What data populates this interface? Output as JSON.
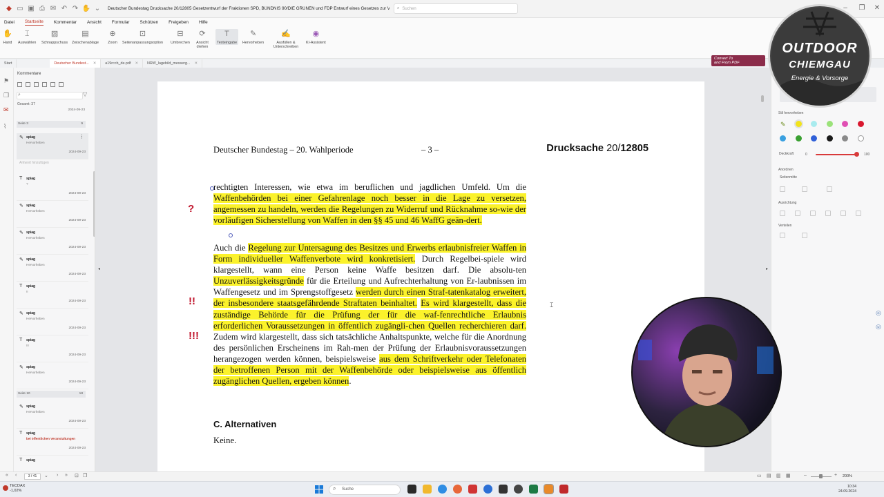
{
  "title_bar": {
    "document_title": "Deutscher Bundestag Drucksache 20/12805 Gesetzentwurf der Fraktionen SPD, BÜNDNIS 90/DIE GRÜNEN und FDP Entwurf eines Gesetzes zur Ve...",
    "search_placeholder": "Suchen"
  },
  "menu": [
    "Datei",
    "Startseite",
    "Kommentar",
    "Ansicht",
    "Formular",
    "Schützen",
    "Freigeben",
    "Hilfe"
  ],
  "ribbon": {
    "tools": [
      {
        "label": "Hand",
        "icon": "hand-icon"
      },
      {
        "label": "Auswählen",
        "icon": "select-icon"
      },
      {
        "label": "Schnappschuss",
        "icon": "snapshot-icon"
      },
      {
        "label": "Zwischenablage",
        "icon": "clipboard-icon"
      },
      {
        "label": "Zoom",
        "icon": "zoom-icon"
      },
      {
        "label": "Seitenanpassungsoption",
        "icon": "fit-page-icon"
      },
      {
        "label": "Umbrechen",
        "icon": "reflow-icon"
      },
      {
        "label": "Ansicht drehen",
        "icon": "rotate-icon"
      },
      {
        "label": "Texteingabe",
        "icon": "text-input-icon"
      },
      {
        "label": "Hervorheben",
        "icon": "highlight-icon"
      },
      {
        "label": "Ausfüllen & Unterschreiben",
        "icon": "fill-sign-icon"
      },
      {
        "label": "KI-Assistent",
        "icon": "ai-assistant-icon"
      }
    ]
  },
  "tabs": [
    {
      "label": "Start"
    },
    {
      "label": "Deutscher Bundest..."
    },
    {
      "label": "a19rccb_de.pdf"
    },
    {
      "label": "NRW_lagebild_messerg..."
    }
  ],
  "convert_badge": {
    "line1": "Convert To",
    "line2": "and From PDF"
  },
  "comments_panel": {
    "title": "Kommentare",
    "search_placeholder": "",
    "total": "Gesamt: 37",
    "first_date": "2024-09-23",
    "page_group_1": {
      "label": "Seite 3",
      "count": "9"
    },
    "reply_placeholder": "Antwort hinzufügen",
    "items": [
      {
        "type_icon": "highlight-pen-icon",
        "author": "spiag",
        "type": "Hervorheben",
        "date": "2024-09-23",
        "note": ""
      },
      {
        "type_icon": "text-comment-icon",
        "author": "spiag",
        "type": "?",
        "date": "2024-09-23",
        "note": ""
      },
      {
        "type_icon": "highlight-pen-icon",
        "author": "spiag",
        "type": "Hervorheben",
        "date": "2024-09-23",
        "note": ""
      },
      {
        "type_icon": "highlight-pen-icon",
        "author": "spiag",
        "type": "Hervorheben",
        "date": "2024-09-23",
        "note": ""
      },
      {
        "type_icon": "highlight-pen-icon",
        "author": "spiag",
        "type": "Hervorheben",
        "date": "2024-09-23",
        "note": ""
      },
      {
        "type_icon": "text-comment-icon",
        "author": "spiag",
        "type": "!!",
        "date": "2024-09-23",
        "note": ""
      },
      {
        "type_icon": "highlight-pen-icon",
        "author": "spiag",
        "type": "Hervorheben",
        "date": "2024-09-23",
        "note": ""
      },
      {
        "type_icon": "text-comment-icon",
        "author": "spiag",
        "type": "!!!",
        "date": "2024-09-23",
        "note": ""
      },
      {
        "type_icon": "highlight-pen-icon",
        "author": "spiag",
        "type": "Hervorheben",
        "date": "2024-09-23",
        "note": ""
      }
    ],
    "page_group_2": {
      "label": "Seite 10",
      "count": "18"
    },
    "items2": [
      {
        "author": "spiag",
        "type": "Hervorheben",
        "date": "2024-09-23"
      },
      {
        "author": "spiag",
        "type": "bei öffentlichen Veranstaltungen",
        "date": "2024-09-23"
      },
      {
        "author": "spiag",
        "type": "",
        "date": ""
      }
    ]
  },
  "document": {
    "running_head_left": "Deutscher Bundestag – 20. Wahlperiode",
    "page_number": "– 3 –",
    "drucksache_label": "Drucksache",
    "drucksache_num_a": "20/",
    "drucksache_num_b": "12805",
    "para1": [
      {
        "t": "rechtigten Interessen, wie etwa im beruflichen und jagdlichen Umfeld. Um die ",
        "hl": false
      },
      {
        "t": "Waffenbehörden bei einer Gefahrenlage noch besser in die Lage zu versetzen, angemessen zu handeln, werden die Regelungen zu Widerruf und Rücknahme so-wie der vorläufigen Sicherstellung von Waffen in den §§ 45 und 46 WaffG geän-dert.",
        "hl": true
      }
    ],
    "para2": [
      {
        "t": "Auch die ",
        "hl": false
      },
      {
        "t": "Regelung zur Untersagung des Besitzes und Erwerbs erlaubnisfreier Waffen in Form individueller Waffenverbote wird konkretisiert.",
        "hl": true
      },
      {
        "t": " Durch Regelbei-spiele wird klargestellt, wann eine Person keine Waffe besitzen darf. Die absolu-ten ",
        "hl": false
      },
      {
        "t": "Unzuverlässigkeitsgründe",
        "hl": true
      },
      {
        "t": " für die Erteilung und Aufrechterhaltung von Er-laubnissen im Waffengesetz und im Sprengstoffgesetz ",
        "hl": false
      },
      {
        "t": "werden durch einen Straf-tatenkatalog erweitert, der insbesondere staatsgefährdende Straftaten beinhaltet.",
        "hl": true
      },
      {
        "t": " ",
        "hl": false
      },
      {
        "t": "Es wird klargestellt, dass die zuständige Behörde für die Prüfung der für die waf-fenrechtliche Erlaubnis erforderlichen Voraussetzungen in öffentlich zugängli-chen Quellen recherchieren darf.",
        "hl": true
      },
      {
        "t": " Zudem wird klargestellt, dass sich tatsächliche Anhaltspunkte, welche für die Anordnung des persönlichen Erscheinens im Rah-men der Prüfung der Erlaubnisvoraussetzungen herangezogen werden können, beispielsweise ",
        "hl": false
      },
      {
        "t": "aus dem Schriftverkehr oder Telefonaten der betroffenen Person mit der Waffenbehörde oder beispielsweise aus öffentlich zugänglichen Quellen, ergeben können",
        "hl": true
      },
      {
        "t": ".",
        "hl": false
      }
    ],
    "section_heading": "C. Alternativen",
    "section_text": "Keine.",
    "margin_marks": [
      "?",
      "!!",
      "!!!"
    ]
  },
  "right_panel": {
    "style_label": "Stil hervorheben",
    "colors": [
      "#f2e31a",
      "#a8ebee",
      "#9be27a",
      "#e04fb3",
      "#d9182f",
      "#3aa0e0",
      "#3aa032",
      "#3060d8",
      "#1a1a1a",
      "#8a8a8a",
      "#ffffff"
    ],
    "opacity_label": "Deckkraft",
    "opacity_min": "0",
    "opacity_max": "100",
    "opacity_value": 100,
    "arrange_label": "Anordnen",
    "page_center_label": "Seitenmitte",
    "align_label": "Ausrichtung",
    "distribute_label": "Verteilen"
  },
  "logo": {
    "line1": "OUTDOOR",
    "line2": "CHIEMGAU",
    "line3": "Energie & Vorsorge"
  },
  "status_bar": {
    "page": "3 / 41",
    "zoom": "200%"
  },
  "taskbar": {
    "weather_title": "TECDAX",
    "weather_value": "-1,02%",
    "search_label": "Suche",
    "time": "10:34",
    "date": "24.09.2024"
  }
}
